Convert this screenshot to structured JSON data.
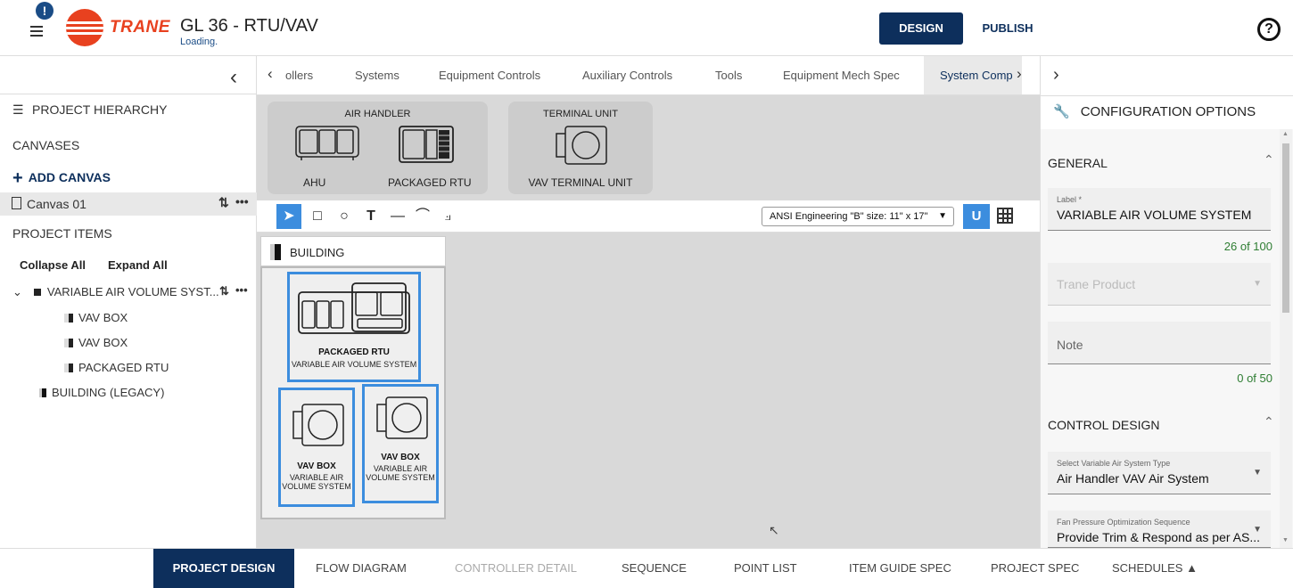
{
  "header": {
    "notification_count": "!",
    "logo_text": "TRANE",
    "title": "GL 36 - RTU/VAV",
    "subtitle": "Loading.",
    "design_label": "DESIGN",
    "publish_label": "PUBLISH",
    "help_glyph": "?"
  },
  "left_panel": {
    "hierarchy_title": "PROJECT HIERARCHY",
    "canvases_label": "CANVASES",
    "add_canvas_label": "ADD CANVAS",
    "canvas_item": "Canvas 01",
    "project_items_label": "PROJECT ITEMS",
    "collapse_all": "Collapse All",
    "expand_all": "Expand All",
    "tree": {
      "root": "VARIABLE AIR VOLUME SYST...",
      "children": [
        "VAV BOX",
        "VAV BOX",
        "PACKAGED RTU"
      ],
      "building": "BUILDING (LEGACY)"
    }
  },
  "tabs": [
    "ollers",
    "Systems",
    "Equipment Controls",
    "Auxiliary Controls",
    "Tools",
    "Equipment Mech Spec",
    "System Comp"
  ],
  "active_tab": "System Comp",
  "palette": {
    "air_handler_header": "AIR HANDLER",
    "ahu_label": "AHU",
    "rtu_label": "PACKAGED RTU",
    "terminal_header": "TERMINAL UNIT",
    "vav_label": "VAV TERMINAL UNIT"
  },
  "toolbar": {
    "paper_size": "ANSI Engineering \"B\" size: 11\" x 17\""
  },
  "canvas": {
    "building_label": "BUILDING",
    "rtu_title": "PACKAGED RTU",
    "rtu_sub": "VARIABLE AIR VOLUME SYSTEM",
    "vav1_title": "VAV BOX",
    "vav1_sub": "VARIABLE AIR VOLUME SYSTEM",
    "vav2_title": "VAV BOX",
    "vav2_sub": "VARIABLE AIR VOLUME SYSTEM"
  },
  "right_panel": {
    "title": "CONFIGURATION OPTIONS",
    "general_label": "GENERAL",
    "label_field_label": "Label *",
    "label_field_value": "VARIABLE AIR VOLUME SYSTEM",
    "label_counter": "26 of 100",
    "trane_product_placeholder": "Trane Product",
    "note_placeholder": "Note",
    "note_counter": "0 of 50",
    "control_design_label": "CONTROL DESIGN",
    "air_system_label": "Select Variable Air System Type",
    "air_system_value": "Air Handler VAV Air System",
    "fan_label": "Fan Pressure Optimization Sequence",
    "fan_value": "Provide Trim & Respond as per AS..."
  },
  "bottom_nav": [
    "PROJECT DESIGN",
    "FLOW DIAGRAM",
    "CONTROLLER DETAIL",
    "SEQUENCE",
    "POINT LIST",
    "ITEM GUIDE SPEC",
    "PROJECT SPEC",
    "SCHEDULES ▲"
  ],
  "colors": {
    "brand": "#e8411f",
    "navy": "#0d2f5c",
    "accent": "#3c8dde",
    "counter_green": "#2e7d32"
  }
}
